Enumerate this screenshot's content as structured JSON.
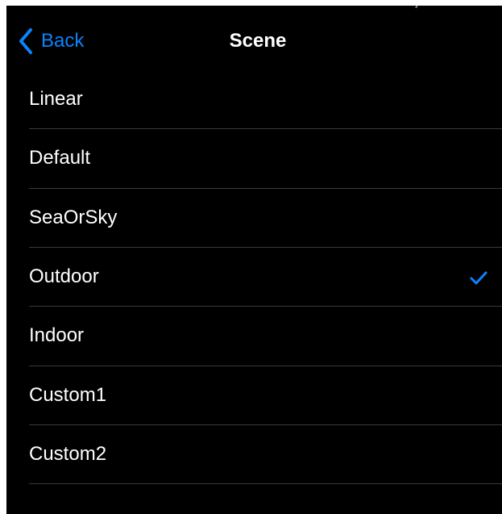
{
  "nav": {
    "back_label": "Back",
    "title": "Scene"
  },
  "scenes": {
    "selected": "Outdoor",
    "items": [
      {
        "label": "Linear"
      },
      {
        "label": "Default"
      },
      {
        "label": "SeaOrSky"
      },
      {
        "label": "Outdoor"
      },
      {
        "label": "Indoor"
      },
      {
        "label": "Custom1"
      },
      {
        "label": "Custom2"
      }
    ]
  },
  "icons": {
    "back": "chevron-left-icon",
    "selected": "checkmark-icon"
  },
  "colors": {
    "background": "#000000",
    "accent": "#0a84ff",
    "text": "#ffffff",
    "separator": "#3a3a3c"
  }
}
